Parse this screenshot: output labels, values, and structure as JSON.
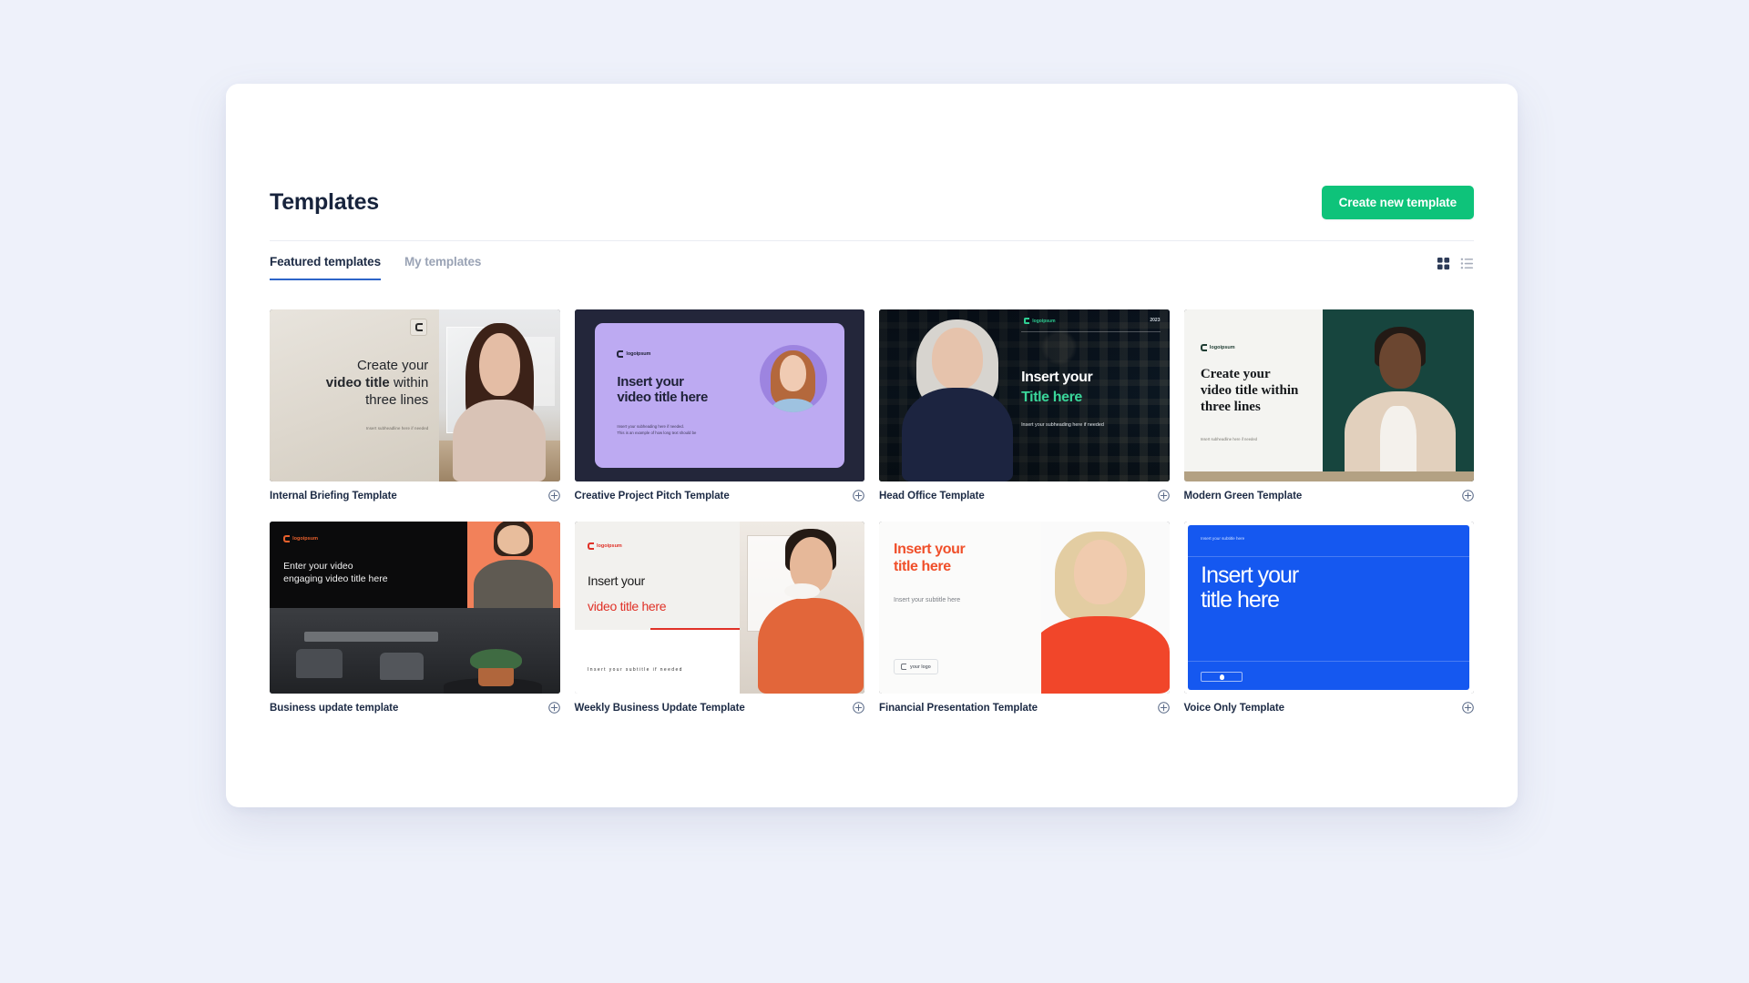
{
  "header": {
    "title": "Templates",
    "create_button": "Create new template"
  },
  "tabs": [
    {
      "label": "Featured templates",
      "active": true
    },
    {
      "label": "My templates",
      "active": false
    }
  ],
  "view_toggle": {
    "grid_icon": "grid-view-icon",
    "list_icon": "list-view-icon",
    "active": "grid"
  },
  "colors": {
    "page_background": "#eef1fa",
    "panel": "#ffffff",
    "accent_green": "#0ec37a",
    "tab_active_underline": "#2d64c8",
    "text_primary": "#1d2b45",
    "text_muted": "#9aa3b5"
  },
  "templates": [
    {
      "name": "Internal Briefing Template",
      "add_icon": "plus-circle-icon",
      "preview": {
        "title_line1": "Create your",
        "title_bold": "video title",
        "title_rest": " within",
        "title_line3": "three lines",
        "subtitle": "Insert subheadline here if needed"
      }
    },
    {
      "name": "Creative Project Pitch Template",
      "add_icon": "plus-circle-icon",
      "preview": {
        "logo": "logoipsum",
        "title_line1": "Insert your",
        "title_line2": "video title here",
        "subtitle_line1": "Insert your subheading here if needed.",
        "subtitle_line2": "This is an example of how long text should be"
      }
    },
    {
      "name": "Head Office Template",
      "add_icon": "plus-circle-icon",
      "preview": {
        "logo": "logoipsum",
        "year": "2023",
        "title_line1": "Insert your",
        "title_line2": "Title here",
        "subtitle": "Insert your subheading here if needed"
      }
    },
    {
      "name": "Modern Green Template",
      "add_icon": "plus-circle-icon",
      "preview": {
        "logo": "logoipsum",
        "title_line1": "Create your",
        "title_line2": "video title within",
        "title_line3": "three lines",
        "subtitle": "Insert subheadline here if needed"
      }
    },
    {
      "name": "Business update template",
      "add_icon": "plus-circle-icon",
      "preview": {
        "logo": "logoipsum",
        "title_line1": "Enter your video",
        "title_line2": "engaging video title here"
      }
    },
    {
      "name": "Weekly Business Update Template",
      "add_icon": "plus-circle-icon",
      "preview": {
        "logo": "logoipsum",
        "title_line1": "Insert your",
        "title_line2": "video title here",
        "subtitle": "Insert your subtitle if needed"
      }
    },
    {
      "name": "Financial Presentation Template",
      "add_icon": "plus-circle-icon",
      "preview": {
        "title_line1": "Insert your",
        "title_line2": "title here",
        "subtitle": "Insert your subtitle here",
        "logo_badge": "your logo"
      }
    },
    {
      "name": "Voice Only Template",
      "add_icon": "plus-circle-icon",
      "preview": {
        "subtitle": "Insert your subtitle here",
        "title_line1": "Insert your",
        "title_line2": "title here"
      }
    }
  ]
}
